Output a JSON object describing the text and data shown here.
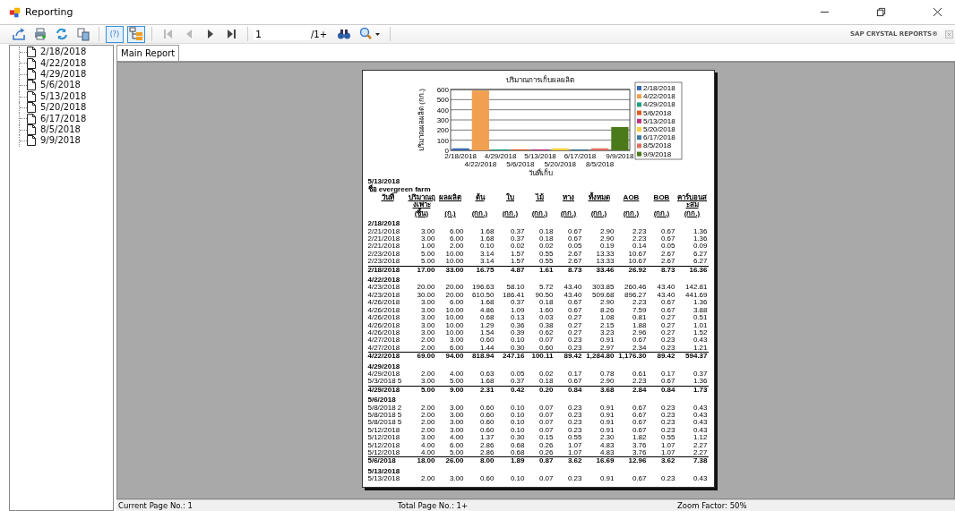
{
  "window": {
    "title": "Reporting"
  },
  "toolbar": {
    "buttons": [
      {
        "kind": "export",
        "on": false,
        "disabled": false
      },
      {
        "kind": "print",
        "on": false,
        "disabled": false
      },
      {
        "kind": "refresh",
        "on": false,
        "disabled": false
      },
      {
        "kind": "copy",
        "on": false,
        "disabled": false
      },
      {
        "kind": "sep"
      },
      {
        "kind": "help",
        "label": "(?)",
        "on": true,
        "disabled": false
      },
      {
        "kind": "tree",
        "on": true,
        "disabled": false
      },
      {
        "kind": "sep"
      },
      {
        "kind": "first",
        "on": false,
        "disabled": true
      },
      {
        "kind": "prev",
        "on": false,
        "disabled": true
      },
      {
        "kind": "next",
        "on": false,
        "disabled": false
      },
      {
        "kind": "last",
        "on": false,
        "disabled": false
      },
      {
        "kind": "sep"
      }
    ],
    "page_field": {
      "value": "1"
    },
    "page_total": "/1+",
    "tools": [
      {
        "kind": "search"
      },
      {
        "kind": "zoom"
      }
    ],
    "brand": "SAP CRYSTAL REPORTS®"
  },
  "group_tree": {
    "items": [
      {
        "label": "2/18/2018",
        "selected": false
      },
      {
        "label": "4/22/2018",
        "selected": false
      },
      {
        "label": "4/29/2018",
        "selected": false
      },
      {
        "label": "5/6/2018",
        "selected": false
      },
      {
        "label": "5/13/2018",
        "selected": false
      },
      {
        "label": "5/20/2018",
        "selected": false
      },
      {
        "label": "6/17/2018",
        "selected": false
      },
      {
        "label": "8/5/2018",
        "selected": false
      },
      {
        "label": "9/9/2018",
        "selected": false
      }
    ]
  },
  "tabs": [
    {
      "label": "Main Report",
      "selected": true
    }
  ],
  "report": {
    "chart_data": {
      "type": "bar",
      "title": "ปริมาณการเก็บผลผลิต",
      "xlabel": "วันที่เก็บ",
      "ylabel": "ปริมาณผลผลิต (กก.)",
      "categories": [
        "2/18/2018",
        "4/22/2018",
        "4/29/2018",
        "5/6/2018",
        "5/13/2018",
        "5/20/2018",
        "6/17/2018",
        "8/5/2018",
        "9/9/2018"
      ],
      "series": [
        {
          "name": "2/18/2018",
          "color": "#3b6bb0",
          "values": [
            20,
            null,
            null,
            null,
            null,
            null,
            null,
            null,
            null
          ]
        },
        {
          "name": "4/22/2018",
          "color": "#f0a050",
          "values": [
            null,
            590,
            null,
            null,
            null,
            null,
            null,
            null,
            null
          ]
        },
        {
          "name": "4/29/2018",
          "color": "#20a080",
          "values": [
            null,
            null,
            10,
            null,
            null,
            null,
            null,
            null,
            null
          ]
        },
        {
          "name": "5/6/2018",
          "color": "#e05a20",
          "values": [
            null,
            null,
            null,
            10,
            null,
            null,
            null,
            null,
            null
          ]
        },
        {
          "name": "5/13/2018",
          "color": "#c03080",
          "values": [
            null,
            null,
            null,
            null,
            10,
            null,
            null,
            null,
            null
          ]
        },
        {
          "name": "5/20/2018",
          "color": "#f5d040",
          "values": [
            null,
            null,
            null,
            null,
            null,
            20,
            null,
            null,
            null
          ]
        },
        {
          "name": "6/17/2018",
          "color": "#3a7aa0",
          "values": [
            null,
            null,
            null,
            null,
            null,
            null,
            10,
            null,
            null
          ]
        },
        {
          "name": "8/5/2018",
          "color": "#e07060",
          "values": [
            null,
            null,
            null,
            null,
            null,
            null,
            null,
            20,
            null
          ]
        },
        {
          "name": "9/9/2018",
          "color": "#4a7a1a",
          "values": [
            null,
            null,
            null,
            null,
            null,
            null,
            null,
            null,
            230
          ]
        }
      ],
      "grid": true,
      "legend": true,
      "ylim": [
        0,
        600
      ],
      "yticks": [
        0,
        100,
        200,
        300,
        400,
        500,
        600
      ]
    },
    "date": "5/13/2018",
    "farm": "ชื่อ evergreen farm",
    "columns": [
      {
        "label": "วันที่"
      },
      {
        "label": "ปริมาณถุงเพาะ",
        "unit": "(ชิ้น)"
      },
      {
        "label": "ผลผลิต",
        "unit": "(ก.)"
      },
      {
        "label": "ต้น",
        "unit": "(กก.)"
      },
      {
        "label": "ใบ",
        "unit": "(กก.)"
      },
      {
        "label": "ไม้",
        "unit": "(กก.)"
      },
      {
        "label": "หาง",
        "unit": "(กก.)"
      },
      {
        "label": "ทั้งหมด",
        "unit": "(กก.)"
      },
      {
        "label": "AOB",
        "unit": "(กก.)"
      },
      {
        "label": "BOB",
        "unit": "(กก.)"
      },
      {
        "label": "คาร์บอนสะสม",
        "unit": "(กก.)"
      }
    ],
    "groups": [
      {
        "header": "2/18/2018",
        "rows": [
          [
            "2/21/2018",
            "3.00",
            "6.00",
            "1.68",
            "0.37",
            "0.18",
            "0.67",
            "2.90",
            "2.23",
            "0.67",
            "1.36"
          ],
          [
            "2/21/2018",
            "3.00",
            "6.00",
            "1.68",
            "0.37",
            "0.18",
            "0.67",
            "2.90",
            "2.23",
            "0.67",
            "1.36"
          ],
          [
            "2/21/2018",
            "1.00",
            "2.00",
            "0.10",
            "0.02",
            "0.02",
            "0.05",
            "0.19",
            "0.14",
            "0.05",
            "0.09"
          ],
          [
            "2/23/2018",
            "5.00",
            "10.00",
            "3.14",
            "1.57",
            "0.55",
            "2.67",
            "13.33",
            "10.67",
            "2.67",
            "6.27"
          ],
          [
            "2/23/2018",
            "5.00",
            "10.00",
            "3.14",
            "1.57",
            "0.55",
            "2.67",
            "13.33",
            "10.67",
            "2.67",
            "6.27"
          ]
        ],
        "total": [
          "2/18/2018",
          "17.00",
          "33.00",
          "16.75",
          "4.87",
          "1.61",
          "8.73",
          "33.46",
          "26.92",
          "8.73",
          "16.36"
        ]
      },
      {
        "header": "4/22/2018",
        "rows": [
          [
            "4/23/2018",
            "20.00",
            "20.00",
            "196.63",
            "58.10",
            "5.72",
            "43.40",
            "303.85",
            "260.46",
            "43.40",
            "142.81"
          ],
          [
            "4/23/2018",
            "30.00",
            "20.00",
            "610.50",
            "186.41",
            "90.50",
            "43.40",
            "509.68",
            "896.27",
            "43.40",
            "441.69"
          ],
          [
            "4/26/2018",
            "3.00",
            "6.00",
            "1.68",
            "0.37",
            "0.18",
            "0.67",
            "2.90",
            "2.23",
            "0.67",
            "1.36"
          ],
          [
            "4/26/2018",
            "3.00",
            "10.00",
            "4.86",
            "1.09",
            "1.60",
            "0.67",
            "8.26",
            "7.59",
            "0.67",
            "3.88"
          ],
          [
            "4/26/2018",
            "3.00",
            "10.00",
            "0.68",
            "0.13",
            "0.03",
            "0.27",
            "1.08",
            "0.81",
            "0.27",
            "0.51"
          ],
          [
            "4/26/2018",
            "3.00",
            "10.00",
            "1.29",
            "0.36",
            "0.38",
            "0.27",
            "2.15",
            "1.88",
            "0.27",
            "1.01"
          ],
          [
            "4/26/2018",
            "3.00",
            "10.00",
            "1.54",
            "0.39",
            "0.62",
            "0.27",
            "3.23",
            "2.96",
            "0.27",
            "1.52"
          ],
          [
            "4/27/2018",
            "2.00",
            "3.00",
            "0.60",
            "0.10",
            "0.07",
            "0.23",
            "0.91",
            "0.67",
            "0.23",
            "0.43"
          ],
          [
            "4/27/2018",
            "2.00",
            "6.00",
            "1.44",
            "0.30",
            "0.60",
            "0.23",
            "2.97",
            "2.34",
            "0.23",
            "1.21"
          ]
        ],
        "total": [
          "4/22/2018",
          "69.00",
          "94.00",
          "818.94",
          "247.16",
          "100.11",
          "89.42",
          "1,284.80",
          "1,176.30",
          "89.42",
          "594.37"
        ]
      },
      {
        "header": "4/29/2018",
        "rows": [
          [
            "4/29/2018",
            "2.00",
            "4.00",
            "0.63",
            "0.05",
            "0.02",
            "0.17",
            "0.78",
            "0.61",
            "0.17",
            "0.37"
          ],
          [
            "5/3/2018 5",
            "3.00",
            "5.00",
            "1.68",
            "0.37",
            "0.18",
            "0.67",
            "2.90",
            "2.23",
            "0.67",
            "1.36"
          ]
        ],
        "total": [
          "4/29/2018",
          "5.00",
          "9.00",
          "2.31",
          "0.42",
          "0.20",
          "0.84",
          "3.68",
          "2.84",
          "0.84",
          "1.73"
        ]
      },
      {
        "header": "5/6/2018",
        "rows": [
          [
            "5/8/2018 2",
            "2.00",
            "3.00",
            "0.60",
            "0.10",
            "0.07",
            "0.23",
            "0.91",
            "0.67",
            "0.23",
            "0.43"
          ],
          [
            "5/8/2018 5",
            "2.00",
            "3.00",
            "0.60",
            "0.10",
            "0.07",
            "0.23",
            "0.91",
            "0.67",
            "0.23",
            "0.43"
          ],
          [
            "5/8/2018 5",
            "2.00",
            "3.00",
            "0.60",
            "0.10",
            "0.07",
            "0.23",
            "0.91",
            "0.67",
            "0.23",
            "0.43"
          ],
          [
            "5/12/2018",
            "2.00",
            "3.00",
            "0.60",
            "0.10",
            "0.07",
            "0.23",
            "0.91",
            "0.67",
            "0.23",
            "0.43"
          ],
          [
            "5/12/2018",
            "3.00",
            "4.00",
            "1.37",
            "0.30",
            "0.15",
            "0.55",
            "2.30",
            "1.82",
            "0.55",
            "1.12"
          ],
          [
            "5/12/2018",
            "4.00",
            "6.00",
            "2.86",
            "0.68",
            "0.26",
            "1.07",
            "4.83",
            "3.76",
            "1.07",
            "2.27"
          ],
          [
            "5/12/2018",
            "4.00",
            "5.00",
            "2.86",
            "0.68",
            "0.26",
            "1.07",
            "4.83",
            "3.76",
            "1.07",
            "2.27"
          ]
        ],
        "total": [
          "5/6/2018",
          "18.00",
          "26.00",
          "8.00",
          "1.89",
          "0.87",
          "3.62",
          "16.69",
          "12.96",
          "3.62",
          "7.38"
        ]
      },
      {
        "header": "5/13/2018",
        "rows": [
          [
            "5/13/2018",
            "2.00",
            "3.00",
            "0.60",
            "0.10",
            "0.07",
            "0.23",
            "0.91",
            "0.67",
            "0.23",
            "0.43"
          ]
        ]
      }
    ]
  },
  "status_bar": [
    "Current Page No.: 1",
    "Total Page No.: 1+",
    "Zoom Factor: 50%"
  ]
}
